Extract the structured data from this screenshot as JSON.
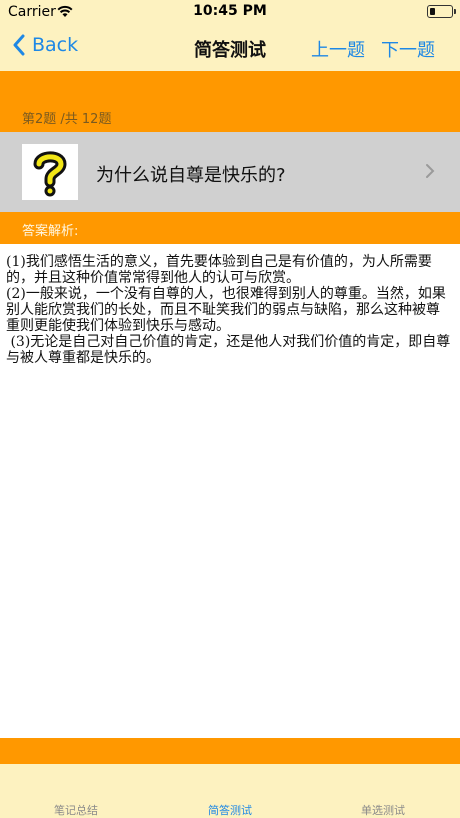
{
  "status_bar": {
    "carrier": "Carrier",
    "time": "10:45 PM"
  },
  "nav": {
    "back_label": "Back",
    "title": "简答测试",
    "prev_label": "上一题",
    "next_label": "下一题"
  },
  "question": {
    "counter": "第2题 /共 12题",
    "text": "为什么说自尊是快乐的?",
    "icon": "question-mark-icon"
  },
  "answer": {
    "label": "答案解析:",
    "paragraphs": [
      "(1)我们感悟生活的意义，首先要体验到自己是有价值的，为人所需要的，并且这种价值常常得到他人的认可与欣赏。",
      "(2)一般来说，一个没有自尊的人，也很难得到别人的尊重。当然，如果别人能欣赏我们的长处，而且不耻笑我们的弱点与缺陷，那么这种被尊重则更能使我们体验到快乐与感动。",
      " (3)无论是自己对自己价值的肯定，还是他人对我们价值的肯定，即自尊与被人尊重都是快乐的。"
    ]
  },
  "tabs": [
    {
      "label": "笔记总结",
      "active": false
    },
    {
      "label": "简答测试",
      "active": true
    },
    {
      "label": "单选测试",
      "active": false
    }
  ],
  "colors": {
    "accent_blue": "#1e88e5",
    "orange_band": "#ff9800",
    "cream": "#fdf2c0",
    "question_bg": "#d0d0d0"
  }
}
